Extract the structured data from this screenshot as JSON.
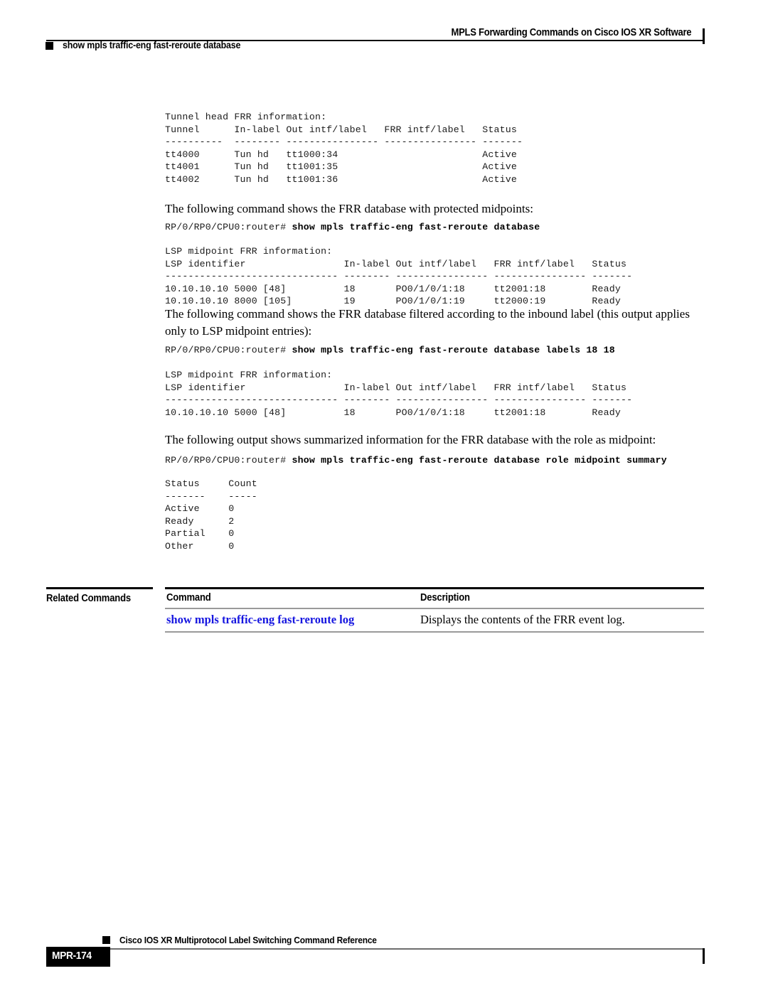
{
  "header": {
    "title": "MPLS Forwarding Commands on Cisco IOS XR Software",
    "subtitle": "show mpls traffic-eng fast-reroute database"
  },
  "body": {
    "code_block_1": "Tunnel head FRR information:\nTunnel      In-label Out intf/label   FRR intf/label   Status\n----------  -------- ---------------- ---------------- -------\ntt4000      Tun hd   tt1000:34                         Active\ntt4001      Tun hd   tt1001:35                         Active\ntt4002      Tun hd   tt1001:36                         Active",
    "para_1": "The following command shows the FRR database with protected midpoints:",
    "cmd_1_prompt": "RP/0/RP0/CPU0:router# ",
    "cmd_1_command": "show mpls traffic-eng fast-reroute database",
    "code_block_2": "LSP midpoint FRR information:\nLSP identifier                 In-label Out intf/label   FRR intf/label   Status\n------------------------------ -------- ---------------- ---------------- -------\n10.10.10.10 5000 [48]          18       PO0/1/0/1:18     tt2001:18        Ready\n10.10.10.10 8000 [105]         19       PO0/1/0/1:19     tt2000:19        Ready",
    "para_2": "The following command shows the FRR database filtered according to the inbound label (this output applies only to LSP midpoint entries):",
    "cmd_2_prompt": "RP/0/RP0/CPU0:router# ",
    "cmd_2_command": "show mpls traffic-eng fast-reroute database labels 18 18",
    "code_block_3": "LSP midpoint FRR information:\nLSP identifier                 In-label Out intf/label   FRR intf/label   Status\n------------------------------ -------- ---------------- ---------------- -------\n10.10.10.10 5000 [48]          18       PO0/1/0/1:18     tt2001:18        Ready",
    "para_3": "The following output shows summarized information for the FRR database with the role as midpoint:",
    "cmd_3_prompt": "RP/0/RP0/CPU0:router# ",
    "cmd_3_command": "show mpls traffic-eng fast-reroute database role midpoint summary",
    "code_block_4": "Status     Count\n-------    -----\nActive     0\nReady      2\nPartial    0\nOther      0"
  },
  "related_commands": {
    "section_label": "Related Commands",
    "columns": [
      "Command",
      "Description"
    ],
    "rows": [
      {
        "command": "show mpls traffic-eng fast-reroute log",
        "description": "Displays the contents of the FRR event log."
      }
    ]
  },
  "footer": {
    "document_title": "Cisco IOS XR Multiprotocol Label Switching Command Reference",
    "page_number": "MPR-174"
  },
  "colors": {
    "link_blue": "#1616e0",
    "rule_black": "#000000",
    "rule_gray": "#9a9a9a"
  }
}
